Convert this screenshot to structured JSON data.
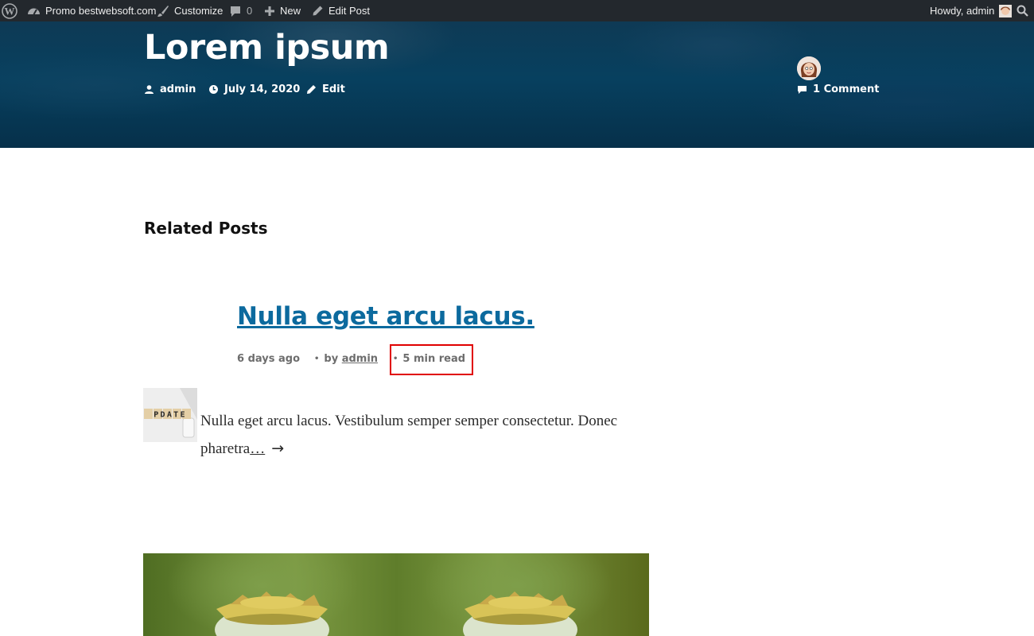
{
  "admin_bar": {
    "site_name": "Promo bestwebsoft.com",
    "customize": "Customize",
    "comments_count": "0",
    "new": "New",
    "edit_post": "Edit Post",
    "greeting": "Howdy, admin"
  },
  "post_header": {
    "title": "Lorem ipsum",
    "author": "admin",
    "date": "July 14, 2020",
    "edit": "Edit",
    "comments": "1 Comment"
  },
  "related": {
    "heading": "Related Posts",
    "items": [
      {
        "title": "Nulla eget arcu lacus.",
        "time_ago": "6 days ago",
        "by_label": "by",
        "author": "admin",
        "read_time": "5 min read",
        "thumbnail_text": "PDATE",
        "excerpt": "Nulla eget arcu lacus. Vestibulum semper semper consectetur. Donec pharetra",
        "read_more": "…",
        "arrow": "→"
      }
    ]
  },
  "colors": {
    "admin_bar_bg": "#23282d",
    "hero_bg": "#07405f",
    "link": "#0c6a9e",
    "highlight_border": "#e00000"
  }
}
